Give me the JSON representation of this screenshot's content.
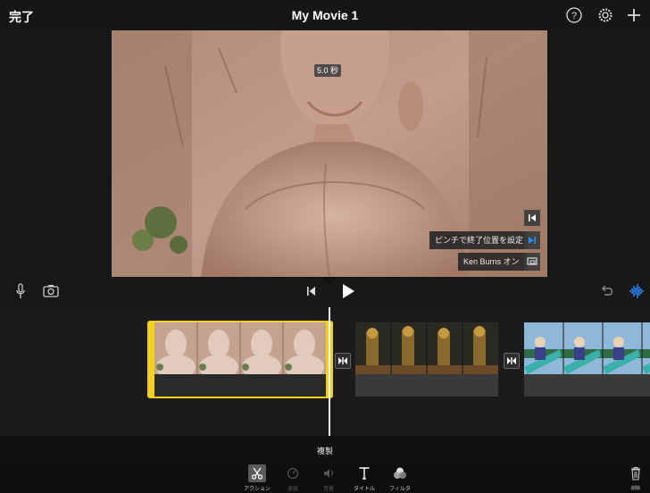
{
  "header": {
    "done_label": "完了",
    "title": "My Movie 1"
  },
  "preview": {
    "duration_badge": "5.0 秒",
    "pinch_hint": "ピンチで終了位置を設定",
    "ken_burns_label": "Ken Burns オン"
  },
  "controls": {
    "mic_icon": "microphone-icon",
    "camera_icon": "camera-icon",
    "play_icon": "play-icon",
    "undo_icon": "undo-icon",
    "audio_icon": "audio-waveform-icon"
  },
  "timeline": {
    "clips": [
      {
        "name": "buddha-clip",
        "selected": true
      },
      {
        "name": "statues-clip",
        "selected": false
      },
      {
        "name": "people-clip",
        "selected": false
      }
    ]
  },
  "bottom": {
    "action_title": "複製"
  },
  "toolbar": {
    "items": [
      {
        "label": "アクション",
        "icon": "scissors-icon",
        "active": true
      },
      {
        "label": "速度",
        "icon": "speedometer-icon",
        "active": false
      },
      {
        "label": "音量",
        "icon": "speaker-icon",
        "active": false
      },
      {
        "label": "タイトル",
        "icon": "title-t-icon",
        "active": true
      },
      {
        "label": "フィルタ",
        "icon": "filter-circles-icon",
        "active": true
      }
    ],
    "delete_label": "削除"
  },
  "colors": {
    "selection": "#f2d01e",
    "accent_blue": "#2d8cff"
  }
}
